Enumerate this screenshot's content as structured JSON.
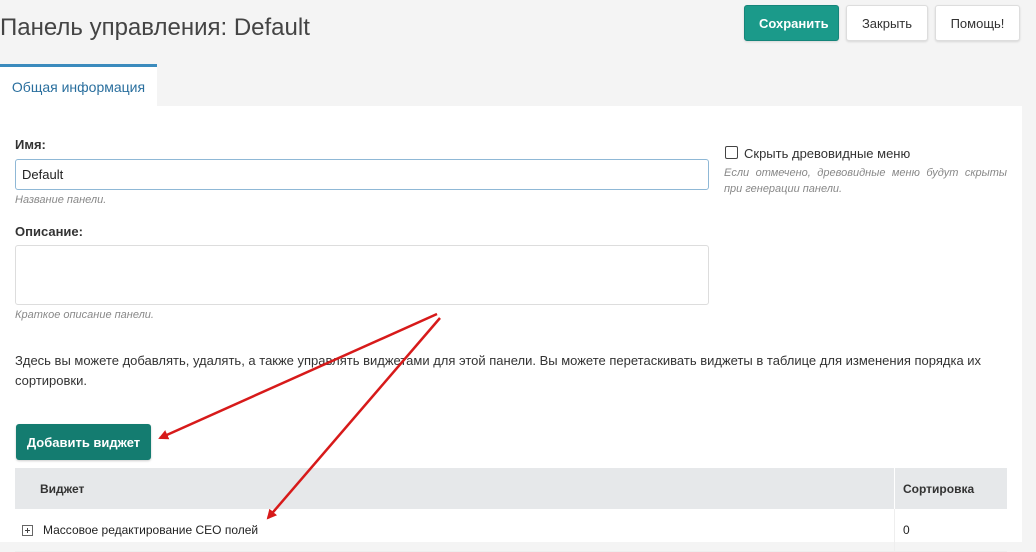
{
  "header": {
    "title": "Панель управления: Default",
    "save_label": "Сохранить",
    "close_label": "Закрыть",
    "help_label": "Помощь!"
  },
  "tabs": [
    {
      "label": "Общая информация",
      "active": true
    }
  ],
  "form": {
    "name_label": "Имя:",
    "name_value": "Default",
    "name_hint": "Название панели.",
    "description_label": "Описание:",
    "description_value": "",
    "description_hint": "Краткое описание панели.",
    "hide_tree_label": "Скрыть древовидные меню",
    "hide_tree_checked": false,
    "hide_tree_hint": "Если отмечено, древовидные меню будут скрыты при генерации панели."
  },
  "info_text": "Здесь вы можете добавлять, удалять, а также управлять виджетами для этой панели. Вы можете перетаскивать виджеты в таблице для изменения порядка их сортировки.",
  "add_widget_label": "Добавить виджет",
  "table": {
    "columns": [
      "Виджет",
      "Сортировка"
    ],
    "rows": [
      {
        "widget": "Массовое редактирование СЕО полей",
        "sort": "0"
      }
    ]
  },
  "colors": {
    "primary": "#1b9a8a",
    "add_button": "#147c70",
    "tab_accent": "#3b8bbd",
    "annotation_arrow": "#d71a1a"
  }
}
